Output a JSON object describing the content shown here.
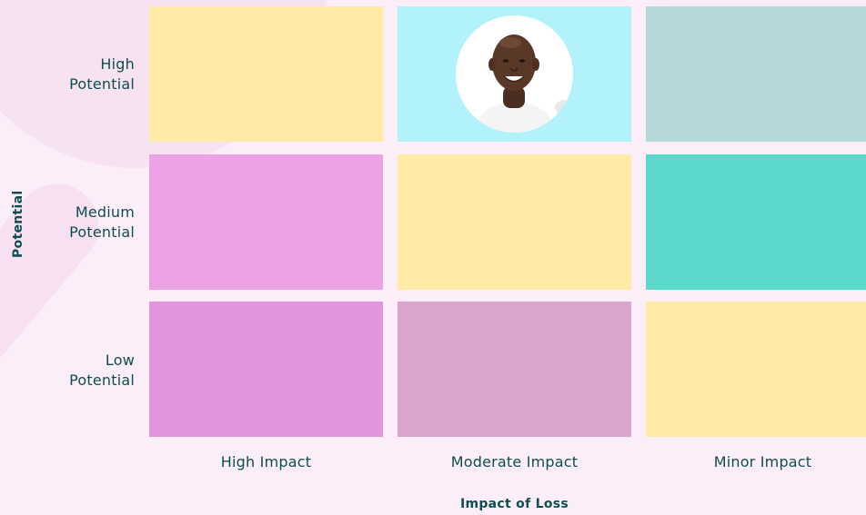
{
  "rows": [
    {
      "label": "High\nPotential"
    },
    {
      "label": "Medium\nPotential"
    },
    {
      "label": "Low\nPotential"
    }
  ],
  "columns": [
    {
      "label": "High Impact"
    },
    {
      "label": "Moderate Impact"
    },
    {
      "label": "Minor Impact"
    }
  ],
  "axes": {
    "y_label": "Potential",
    "x_label": "Impact of Loss"
  },
  "cell_colors": [
    [
      "#ffeaa6",
      "#b2f3fb",
      "#b5d8d8"
    ],
    [
      "#eca3e6",
      "#ffeaa6",
      "#5bd8c9"
    ],
    [
      "#e195dc",
      "#dba4cb",
      "#ffeaa6"
    ]
  ],
  "avatar": {
    "icon": "person-avatar-icon",
    "row": 0,
    "col": 1
  },
  "colors": {
    "background": "#fbeef8",
    "text": "#0e4e52"
  }
}
